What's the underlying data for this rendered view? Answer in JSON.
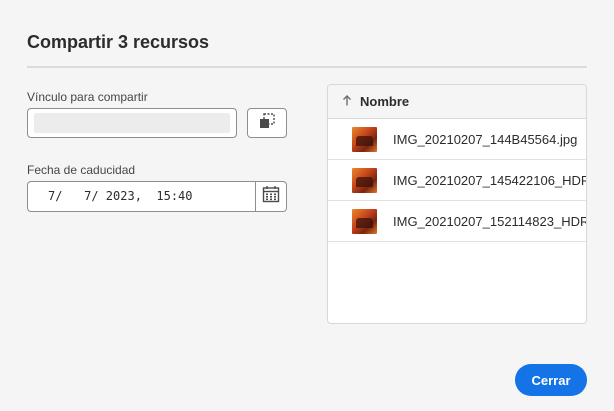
{
  "dialog": {
    "title": "Compartir 3 recursos",
    "close_label": "Cerrar"
  },
  "share_link": {
    "label": "Vínculo para compartir",
    "value": ""
  },
  "expiry": {
    "label": "Fecha de caducidad",
    "value": "7/   7/ 2023,  15:40"
  },
  "file_list": {
    "header": "Nombre",
    "sort": "ascending",
    "items": [
      {
        "name": "IMG_20210207_144B45564.jpg"
      },
      {
        "name": "IMG_20210207_145422106_HDR"
      },
      {
        "name": "IMG_20210207_152114823_HDR."
      }
    ]
  },
  "colors": {
    "accent": "#1473e6",
    "background": "#f5f5f5"
  }
}
